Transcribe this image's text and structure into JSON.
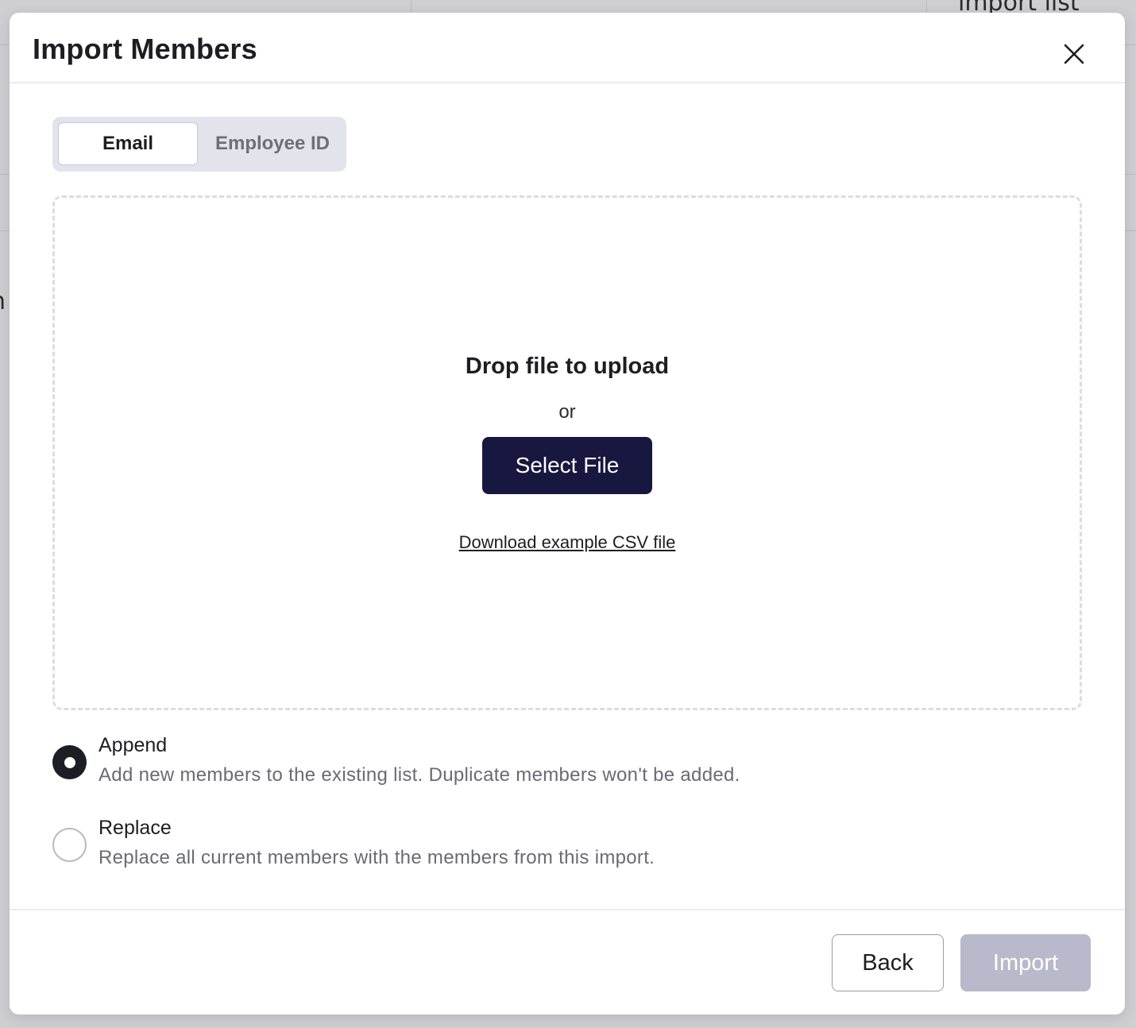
{
  "background": {
    "top_right_text": "import list",
    "left_edge_text": "n"
  },
  "dialog": {
    "title": "Import Members",
    "close_icon": "close-icon"
  },
  "identifier_toggle": {
    "options": [
      {
        "label": "Email",
        "selected": true
      },
      {
        "label": "Employee ID",
        "selected": false
      }
    ]
  },
  "dropzone": {
    "title": "Drop file to upload",
    "or_text": "or",
    "select_button": "Select File",
    "download_link": "Download example CSV file"
  },
  "import_mode": {
    "options": [
      {
        "label": "Append",
        "description": "Add new members to the existing list. Duplicate members won't be added.",
        "checked": true
      },
      {
        "label": "Replace",
        "description": "Replace all current members with the members from this import.",
        "checked": false
      }
    ]
  },
  "footer": {
    "back_label": "Back",
    "import_label": "Import",
    "import_enabled": false
  },
  "colors": {
    "primary": "#17173f",
    "disabled_button": "#b9b9cc",
    "text": "#1d1d24",
    "muted_text": "#6a6a76"
  }
}
